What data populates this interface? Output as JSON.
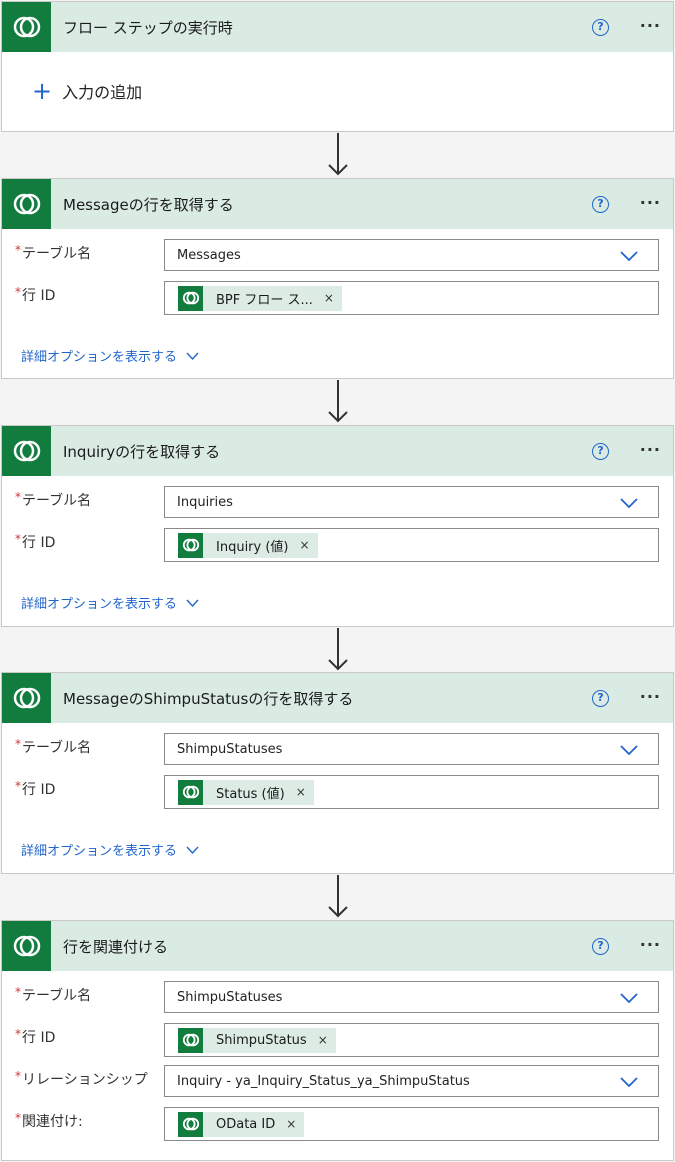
{
  "trigger": {
    "title": "フロー ステップの実行時",
    "add_input_label": "入力の追加"
  },
  "common": {
    "help_glyph": "?",
    "more_glyph": "···",
    "required_mark": "*",
    "remove_glyph": "×",
    "table_name_label": "テーブル名",
    "row_id_label": "行 ID",
    "advanced_options_label": "詳細オプションを表示する"
  },
  "step1": {
    "title": "Messageの行を取得する",
    "table_name_value": "Messages",
    "row_id_token": "BPF フロー ス..."
  },
  "step2": {
    "title": "Inquiryの行を取得する",
    "table_name_value": "Inquiries",
    "row_id_token": "Inquiry (値)"
  },
  "step3": {
    "title": "MessageのShimpuStatusの行を取得する",
    "table_name_value": "ShimpuStatuses",
    "row_id_token": "Status (値)"
  },
  "step4": {
    "title": "行を関連付ける",
    "table_name_value": "ShimpuStatuses",
    "row_id_token": "ShimpuStatus",
    "relationship_label": "リレーションシップ",
    "relationship_value": "Inquiry - ya_Inquiry_Status_ya_ShimpuStatus",
    "relate_with_label": "関連付け:",
    "relate_with_token": "OData ID"
  },
  "colors": {
    "dataverse_green": "#127c3f",
    "header_bg": "#d9ebe3",
    "link_blue": "#2266cc",
    "required_red": "#d13438"
  }
}
